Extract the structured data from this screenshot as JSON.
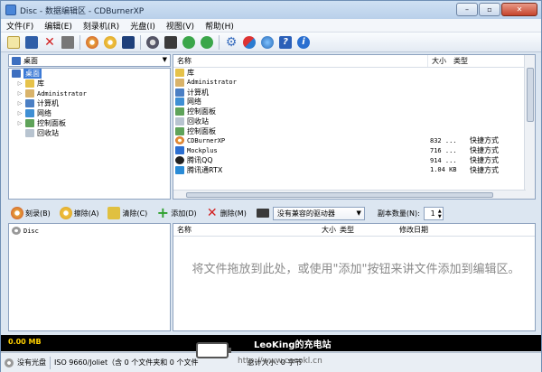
{
  "window": {
    "title": "Disc - 数据编辑区 - CDBurnerXP",
    "buttons": {
      "min": "–",
      "max": "▫",
      "close": "✕"
    }
  },
  "menu": [
    "文件(F)",
    "编辑(E)",
    "刻录机(R)",
    "光盘(I)",
    "视图(V)",
    "帮助(H)"
  ],
  "toolbar_icons": [
    "new-icon",
    "save-icon",
    "delete-icon",
    "print-icon",
    "burn-icon",
    "erase-icon",
    "clear-icon",
    "drive-icon",
    "drive2-icon",
    "next-icon",
    "back-icon",
    "settings-icon",
    "tools-icon",
    "globe-icon",
    "help-icon",
    "info-icon"
  ],
  "explorer": {
    "drive_label": "桌面",
    "tree": [
      {
        "label": "桌面",
        "level": 0,
        "selected": true,
        "icon": "desktop-icon"
      },
      {
        "label": "库",
        "level": 1,
        "icon": "library-icon"
      },
      {
        "label": "Administrator",
        "level": 1,
        "icon": "user-icon"
      },
      {
        "label": "计算机",
        "level": 1,
        "icon": "computer-icon"
      },
      {
        "label": "网络",
        "level": 1,
        "icon": "network-icon"
      },
      {
        "label": "控制面板",
        "level": 1,
        "icon": "control-panel-icon"
      },
      {
        "label": "回收站",
        "level": 1,
        "icon": "recycle-bin-icon"
      }
    ],
    "columns": {
      "name": "名称",
      "size": "大小",
      "type": "类型"
    },
    "files": [
      {
        "name": "库",
        "size": "",
        "type": "",
        "icon": "library-icon"
      },
      {
        "name": "Administrator",
        "size": "",
        "type": "",
        "icon": "user-icon"
      },
      {
        "name": "计算机",
        "size": "",
        "type": "",
        "icon": "computer-icon"
      },
      {
        "name": "网络",
        "size": "",
        "type": "",
        "icon": "network-icon"
      },
      {
        "name": "控制面板",
        "size": "",
        "type": "",
        "icon": "control-panel-icon"
      },
      {
        "name": "回收站",
        "size": "",
        "type": "",
        "icon": "recycle-bin-icon"
      },
      {
        "name": "控制面板",
        "size": "",
        "type": "",
        "icon": "control-panel-icon"
      },
      {
        "name": "CDBurnerXP",
        "size": "832 ...",
        "type": "快捷方式",
        "icon": "cdburner-icon"
      },
      {
        "name": "Mockplus",
        "size": "716 ...",
        "type": "快捷方式",
        "icon": "mockplus-icon"
      },
      {
        "name": "腾讯QQ",
        "size": "914 ...",
        "type": "快捷方式",
        "icon": "qq-icon"
      },
      {
        "name": "腾讯通RTX",
        "size": "1.04 KB",
        "type": "快捷方式",
        "icon": "rtx-icon"
      }
    ]
  },
  "actions": {
    "burn": "刻录(B)",
    "erase": "擦除(A)",
    "clear": "清除(C)",
    "add": "添加(D)",
    "delete": "删除(M)",
    "drive_select": "没有兼容的驱动器",
    "copies_label": "副本数量(N):",
    "copies_value": "1"
  },
  "compilation": {
    "root": "Disc",
    "columns": {
      "name": "名称",
      "size": "大小",
      "type": "类型",
      "modified": "修改日期"
    },
    "hint": "将文件拖放到此处，或使用\"添加\"按钮来讲文件添加到编辑区。"
  },
  "capacity": {
    "used": "0.00 MB"
  },
  "status": {
    "disc": "没有光盘",
    "info": "ISO 9660/Joliet（含 0 个文件夹和 0 个文件",
    "tail": "总计大小: 0 字节"
  },
  "watermark": {
    "text": "LeoKing的充电站",
    "url": "http://www.cocokl.cn"
  },
  "colors": {
    "accent": "#3d7bd6",
    "capacity_bg": "#000000",
    "capacity_text": "#ffd000"
  }
}
